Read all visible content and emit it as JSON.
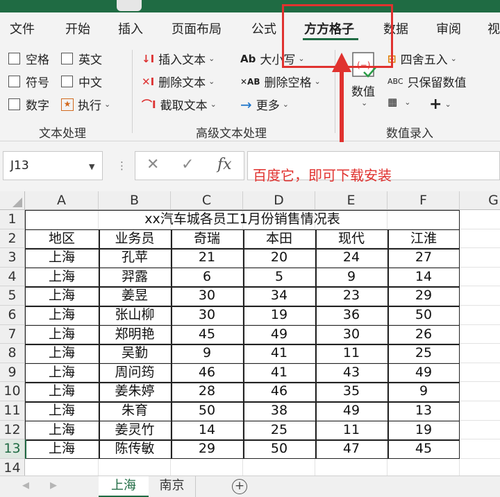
{
  "ribbon_tabs": [
    "文件",
    "开始",
    "插入",
    "页面布局",
    "公式",
    "方方格子",
    "数据",
    "审阅",
    "视"
  ],
  "active_tab": "方方格子",
  "text_group": {
    "label": "文本处理",
    "checks": [
      "空格",
      "英文",
      "符号",
      "中文",
      "数字"
    ],
    "execute": "执行"
  },
  "advanced_group": {
    "label": "高级文本处理",
    "insert": "插入文本",
    "delete": "删除文本",
    "extract": "截取文本",
    "case": "大小写",
    "remove_space": "删除空格",
    "more": "更多"
  },
  "number_group": {
    "label": "数值录入",
    "value": "数值",
    "round": "四舍五入",
    "keep_value": "只保留数值"
  },
  "name_box": "J13",
  "annotation": "百度它，即可下载安装",
  "columns": [
    "A",
    "B",
    "C",
    "D",
    "E",
    "F",
    "G"
  ],
  "row_numbers": [
    "1",
    "2",
    "3",
    "4",
    "5",
    "6",
    "7",
    "8",
    "9",
    "10",
    "11",
    "12",
    "13",
    "14"
  ],
  "sheet": {
    "title": "xx汽车城各员工1月份销售情况表",
    "headers": [
      "地区",
      "业务员",
      "奇瑞",
      "本田",
      "现代",
      "江淮"
    ],
    "rows": [
      [
        "上海",
        "孔苹",
        "21",
        "20",
        "24",
        "27"
      ],
      [
        "上海",
        "羿露",
        "6",
        "5",
        "9",
        "14"
      ],
      [
        "上海",
        "姜昱",
        "30",
        "34",
        "23",
        "29"
      ],
      [
        "上海",
        "张山柳",
        "30",
        "19",
        "36",
        "50"
      ],
      [
        "上海",
        "郑明艳",
        "45",
        "49",
        "30",
        "26"
      ],
      [
        "上海",
        "吴勤",
        "9",
        "41",
        "11",
        "25"
      ],
      [
        "上海",
        "周问筠",
        "46",
        "41",
        "43",
        "49"
      ],
      [
        "上海",
        "姜朱婷",
        "28",
        "46",
        "35",
        "9"
      ],
      [
        "上海",
        "朱育",
        "50",
        "38",
        "49",
        "13"
      ],
      [
        "上海",
        "姜灵竹",
        "14",
        "25",
        "11",
        "19"
      ],
      [
        "上海",
        "陈传敏",
        "29",
        "50",
        "47",
        "45"
      ]
    ]
  },
  "sheet_tabs": [
    "上海",
    "南京"
  ],
  "colors": {
    "accent": "#1f6b43",
    "annotation_red": "#e0322f"
  }
}
